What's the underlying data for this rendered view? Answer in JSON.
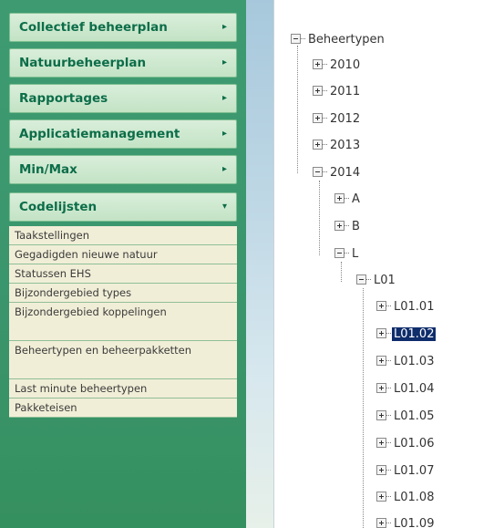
{
  "sidebar": {
    "menus": [
      {
        "label": "Collectief beheerplan",
        "arrow": "▸"
      },
      {
        "label": "Natuurbeheerplan",
        "arrow": "▸"
      },
      {
        "label": "Rapportages",
        "arrow": "▸"
      },
      {
        "label": "Applicatiemanagement",
        "arrow": "▸"
      },
      {
        "label": "Min/Max",
        "arrow": "▸"
      },
      {
        "label": "Codelijsten",
        "arrow": "▾"
      }
    ],
    "codelijsten_items": [
      "Taakstellingen",
      "Gegadigden nieuwe natuur",
      "Statussen EHS",
      "Bijzondergebied types",
      "Bijzondergebied koppelingen",
      "Beheertypen en beheerpakketten",
      "Last minute beheertypen",
      "Pakketeisen"
    ]
  },
  "tree": {
    "root": "Beheertypen",
    "years": [
      "2010",
      "2011",
      "2012",
      "2013",
      "2014"
    ],
    "letters": [
      "A",
      "B",
      "L"
    ],
    "group": "L01",
    "leaves": [
      "L01.01",
      "L01.02",
      "L01.03",
      "L01.04",
      "L01.05",
      "L01.06",
      "L01.07",
      "L01.08",
      "L01.09"
    ],
    "selected": "L01.02"
  }
}
